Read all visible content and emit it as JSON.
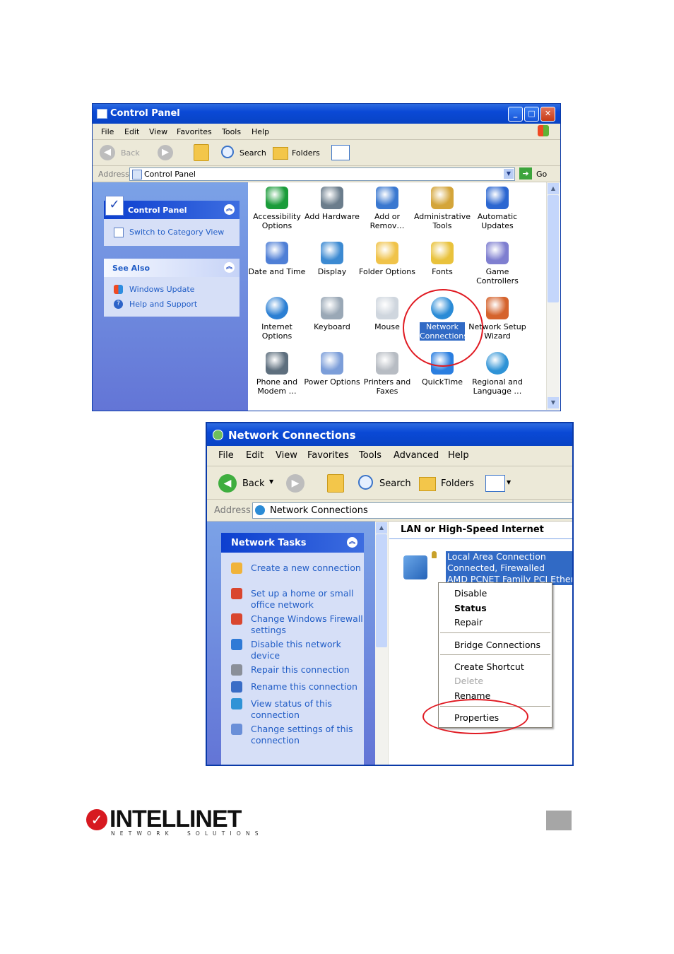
{
  "control_panel": {
    "title": "Control Panel",
    "menu": [
      "File",
      "Edit",
      "View",
      "Favorites",
      "Tools",
      "Help"
    ],
    "toolbar": {
      "back": "Back",
      "search": "Search",
      "folders": "Folders"
    },
    "address_label": "Address",
    "address_value": "Control Panel",
    "go_label": "Go",
    "side_panel": {
      "title": "Control Panel",
      "link": "Switch to Category View"
    },
    "see_also": {
      "title": "See Also",
      "links": [
        "Windows Update",
        "Help and Support"
      ]
    },
    "items": [
      {
        "label": "Accessibility Options",
        "icon": "accessibility-icon"
      },
      {
        "label": "Add Hardware",
        "icon": "add-hardware-icon"
      },
      {
        "label": "Add or Remov…",
        "icon": "add-remove-programs-icon"
      },
      {
        "label": "Administrative Tools",
        "icon": "administrative-tools-icon"
      },
      {
        "label": "Automatic Updates",
        "icon": "automatic-updates-icon"
      },
      {
        "label": "Date and Time",
        "icon": "date-time-icon"
      },
      {
        "label": "Display",
        "icon": "display-icon"
      },
      {
        "label": "Folder Options",
        "icon": "folder-options-icon"
      },
      {
        "label": "Fonts",
        "icon": "fonts-icon"
      },
      {
        "label": "Game Controllers",
        "icon": "game-controllers-icon"
      },
      {
        "label": "Internet Options",
        "icon": "internet-options-icon"
      },
      {
        "label": "Keyboard",
        "icon": "keyboard-icon"
      },
      {
        "label": "Mouse",
        "icon": "mouse-icon"
      },
      {
        "label": "Network Connections",
        "icon": "network-connections-icon"
      },
      {
        "label": "Network Setup Wizard",
        "icon": "network-setup-wizard-icon"
      },
      {
        "label": "Phone and Modem …",
        "icon": "phone-modem-icon"
      },
      {
        "label": "Power Options",
        "icon": "power-options-icon"
      },
      {
        "label": "Printers and Faxes",
        "icon": "printers-faxes-icon"
      },
      {
        "label": "QuickTime",
        "icon": "quicktime-icon"
      },
      {
        "label": "Regional and Language …",
        "icon": "regional-language-icon"
      }
    ]
  },
  "network_connections": {
    "title": "Network Connections",
    "menu": [
      "File",
      "Edit",
      "View",
      "Favorites",
      "Tools",
      "Advanced",
      "Help"
    ],
    "toolbar": {
      "back": "Back",
      "search": "Search",
      "folders": "Folders"
    },
    "address_label": "Address",
    "address_value": "Network Connections",
    "tasks_title": "Network Tasks",
    "tasks": [
      "Create a new connection",
      "Set up a home or small office network",
      "Change Windows Firewall settings",
      "Disable this network device",
      "Repair this connection",
      "Rename this connection",
      "View status of this connection",
      "Change settings of this connection"
    ],
    "group_header": "LAN or High-Speed Internet",
    "connection": {
      "name": "Local Area Connection",
      "status": "Connected, Firewalled",
      "device": "AMD PCNET Family PCI Ethern"
    },
    "context_menu": {
      "items": [
        "Disable",
        "Status",
        "Repair",
        "Bridge Connections",
        "Create Shortcut",
        "Delete",
        "Rename",
        "Properties"
      ]
    }
  },
  "brand": {
    "name": "INTELLINET",
    "tagline": "NETWORK  SOLUTIONS"
  },
  "colors": {
    "xp_blue": "#0a49d6",
    "highlight": "#316ac5",
    "annotation_red": "#e01a22",
    "link_blue": "#215dc6"
  }
}
